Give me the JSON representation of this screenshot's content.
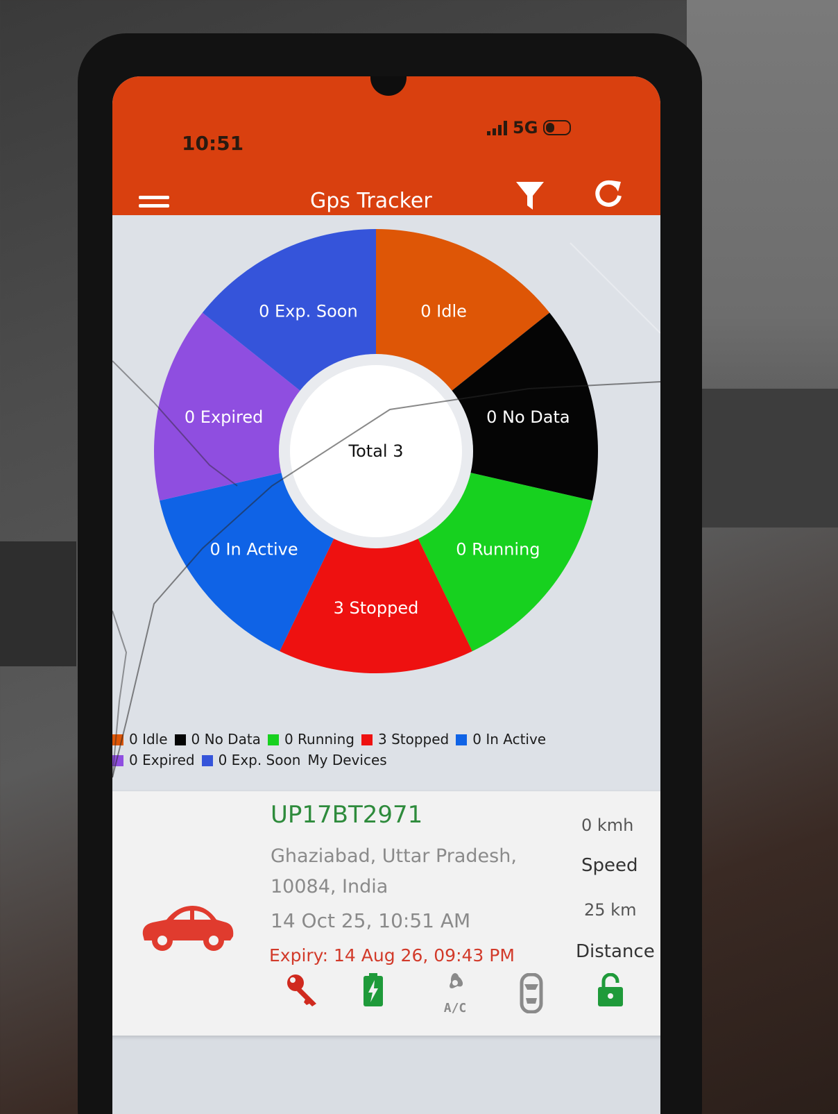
{
  "status_bar": {
    "time": "10:51",
    "network": "5G"
  },
  "app_bar": {
    "title": "Gps Tracker",
    "icons": [
      "menu-icon",
      "filter-icon",
      "refresh-icon"
    ]
  },
  "chart_data": {
    "type": "pie",
    "center_label": "Total 3",
    "slices": [
      {
        "label": "0 Idle",
        "value": 0,
        "color": "#de5606"
      },
      {
        "label": "0 No Data",
        "value": 0,
        "color": "#050505"
      },
      {
        "label": "0 Running",
        "value": 0,
        "color": "#17d11f"
      },
      {
        "label": "3 Stopped",
        "value": 3,
        "color": "#ee1110"
      },
      {
        "label": "0 In Active",
        "value": 0,
        "color": "#0f63e6"
      },
      {
        "label": "0 Expired",
        "value": 0,
        "color": "#8f4ee0"
      },
      {
        "label": "0 Exp. Soon",
        "value": 0,
        "color": "#3554da"
      }
    ]
  },
  "legend": {
    "items": [
      {
        "label": "0 Idle",
        "color": "#de5606"
      },
      {
        "label": "0 No Data",
        "color": "#050505"
      },
      {
        "label": "0 Running",
        "color": "#17d11f"
      },
      {
        "label": "3 Stopped",
        "color": "#ee1110"
      },
      {
        "label": "0 In Active",
        "color": "#0f63e6"
      },
      {
        "label": "0 Expired",
        "color": "#8f4ee0"
      },
      {
        "label": "0 Exp. Soon",
        "color": "#3554da"
      }
    ],
    "section_title": "My Devices"
  },
  "device": {
    "plate": "UP17BT2971",
    "address": "Ghaziabad, Uttar Pradesh, 10084, India",
    "datetime": "14 Oct 25, 10:51 AM",
    "expiry": "Expiry: 14 Aug 26, 09:43 PM",
    "speed_value": "0 kmh",
    "speed_label": "Speed",
    "distance_value": "25 km",
    "distance_label": "Distance",
    "icons": [
      "car-icon",
      "ignition-key-icon",
      "battery-icon",
      "ac-icon",
      "door-icon",
      "lock-open-icon"
    ],
    "colors": {
      "plate": "#2e8b3c",
      "expiry": "#d23a2a",
      "car": "#e03b2e"
    }
  }
}
